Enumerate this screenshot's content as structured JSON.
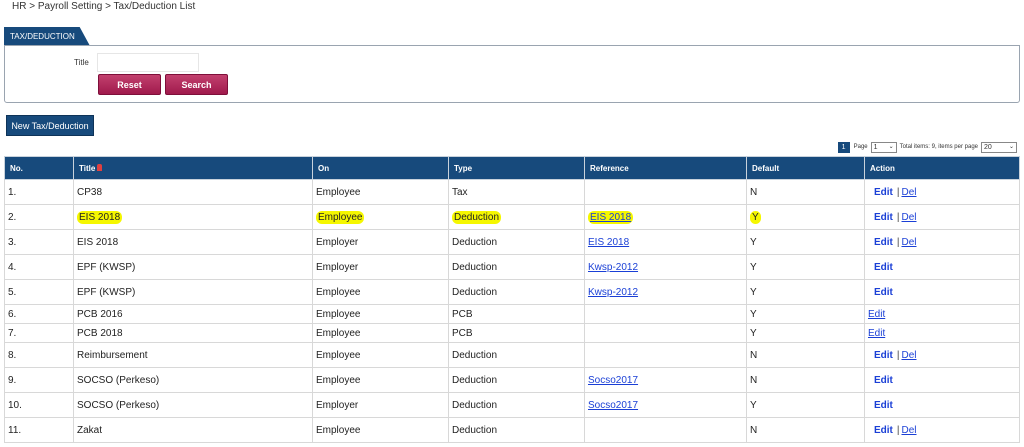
{
  "breadcrumb": "HR > Payroll Setting > Tax/Deduction List",
  "tab_label": "TAX/DEDUCTION",
  "filter": {
    "title_label": "Title",
    "title_value": "",
    "reset_label": "Reset",
    "search_label": "Search"
  },
  "new_button_label": "New Tax/Deduction",
  "pager": {
    "current_page": "1",
    "page_label": "Page",
    "page_value": "1",
    "total_text": "Total items: 9, items per page",
    "per_page_value": "20"
  },
  "columns": [
    "No.",
    "Title",
    "On",
    "Type",
    "Reference",
    "Default",
    "Action"
  ],
  "rows": [
    {
      "no": "1.",
      "title": "CP38",
      "on": "Employee",
      "type": "Tax",
      "reference": "",
      "default": "N",
      "edit": "Edit",
      "del": "Del",
      "highlight": false
    },
    {
      "no": "2.",
      "title": "EIS 2018",
      "on": "Employee",
      "type": "Deduction",
      "reference": "EIS 2018",
      "default": "Y",
      "edit": "Edit",
      "del": "Del",
      "highlight": true
    },
    {
      "no": "3.",
      "title": "EIS 2018",
      "on": "Employer",
      "type": "Deduction",
      "reference": "EIS 2018",
      "default": "Y",
      "edit": "Edit",
      "del": "Del",
      "highlight": false
    },
    {
      "no": "4.",
      "title": "EPF (KWSP)",
      "on": "Employer",
      "type": "Deduction",
      "reference": "Kwsp-2012",
      "default": "Y",
      "edit": "Edit",
      "del": "",
      "highlight": false
    },
    {
      "no": "5.",
      "title": "EPF (KWSP)",
      "on": "Employee",
      "type": "Deduction",
      "reference": "Kwsp-2012",
      "default": "Y",
      "edit": "Edit",
      "del": "",
      "highlight": false
    },
    {
      "no": "6.",
      "title": "PCB 2016",
      "on": "Employee",
      "type": "PCB",
      "reference": "",
      "default": "Y",
      "edit": "Edit",
      "del": "",
      "highlight": false,
      "short": true,
      "plain_edit": true
    },
    {
      "no": "7.",
      "title": "PCB 2018",
      "on": "Employee",
      "type": "PCB",
      "reference": "",
      "default": "Y",
      "edit": "Edit",
      "del": "",
      "highlight": false,
      "short": true,
      "plain_edit": true
    },
    {
      "no": "8.",
      "title": "Reimbursement",
      "on": "Employee",
      "type": "Deduction",
      "reference": "",
      "default": "N",
      "edit": "Edit",
      "del": "Del",
      "highlight": false
    },
    {
      "no": "9.",
      "title": "SOCSO (Perkeso)",
      "on": "Employee",
      "type": "Deduction",
      "reference": "Socso2017",
      "default": "N",
      "edit": "Edit",
      "del": "",
      "highlight": false
    },
    {
      "no": "10.",
      "title": "SOCSO (Perkeso)",
      "on": "Employer",
      "type": "Deduction",
      "reference": "Socso2017",
      "default": "Y",
      "edit": "Edit",
      "del": "",
      "highlight": false
    },
    {
      "no": "11.",
      "title": "Zakat",
      "on": "Employee",
      "type": "Deduction",
      "reference": "",
      "default": "N",
      "edit": "Edit",
      "del": "Del",
      "highlight": false
    }
  ],
  "colors": {
    "primary": "#174a7c",
    "button_red": "#a01a4c",
    "highlight": "#f5f700",
    "link": "#1a3fd6"
  }
}
